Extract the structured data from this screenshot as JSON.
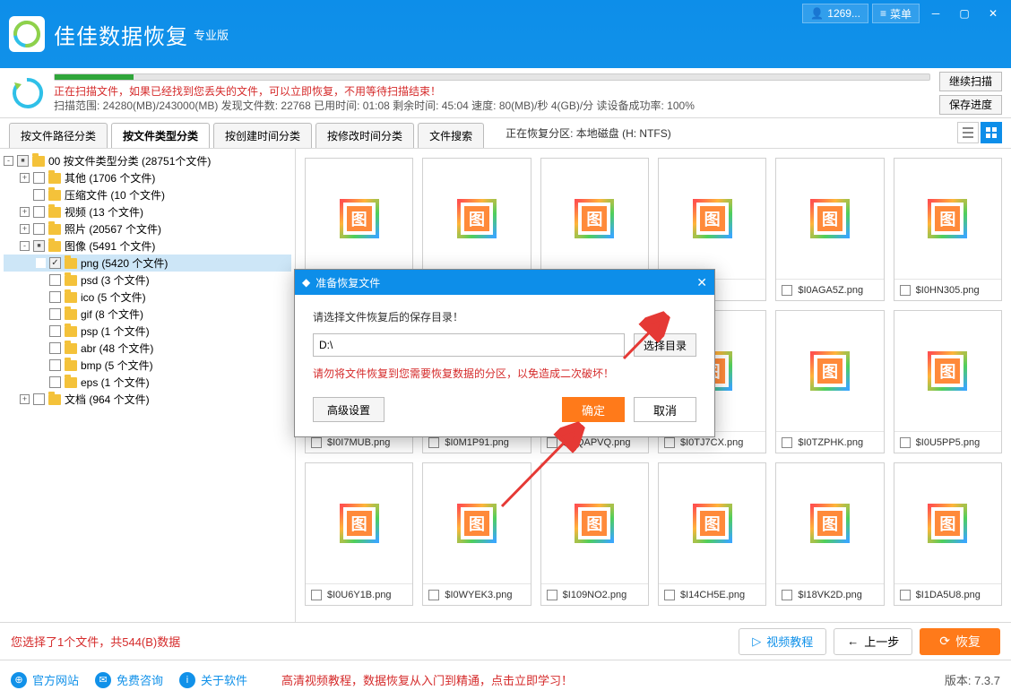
{
  "titlebar": {
    "app_name": "佳佳数据恢复",
    "edition": "专业版",
    "user_btn": "1269...",
    "menu_btn": "菜单"
  },
  "progress": {
    "scanning_msg": "正在扫描文件，如果已经找到您丢失的文件，可以立即恢复，不用等待扫描结束！",
    "stats": "扫描范围: 24280(MB)/243000(MB)   发现文件数: 22768   已用时间: 01:08   剩余时间: 45:04   速度: 80(MB)/秒 4(GB)/分 读设备成功率: 100%",
    "continue_btn": "继续扫描",
    "save_btn": "保存进度"
  },
  "tabs": {
    "t1": "按文件路径分类",
    "t2": "按文件类型分类",
    "t3": "按创建时间分类",
    "t4": "按修改时间分类",
    "t5": "文件搜索",
    "partition": "正在恢复分区: 本地磁盘 (H: NTFS)"
  },
  "tree": {
    "root": "00 按文件类型分类   (28751个文件)",
    "other": "其他   (1706 个文件)",
    "archive": "压缩文件   (10 个文件)",
    "video": "视频   (13 个文件)",
    "photo": "照片   (20567 个文件)",
    "image": "图像   (5491 个文件)",
    "png": "png   (5420 个文件)",
    "psd": "psd   (3 个文件)",
    "ico": "ico   (5 个文件)",
    "gif": "gif   (8 个文件)",
    "psp": "psp   (1 个文件)",
    "abr": "abr   (48 个文件)",
    "bmp": "bmp   (5 个文件)",
    "eps": "eps   (1 个文件)",
    "doc": "文档   (964 个文件)"
  },
  "thumbs": [
    "",
    "",
    "",
    ".ng",
    "$I0AGA5Z.png",
    "$I0HN305.png",
    "$I0I7MUB.png",
    "$I0M1P91.png",
    "$I0QAPVQ.png",
    "$I0TJ7CX.png",
    "$I0TZPHK.png",
    "$I0U5PP5.png",
    "$I0U6Y1B.png",
    "$I0WYEK3.png",
    "$I109NO2.png",
    "$I14CH5E.png",
    "$I18VK2D.png",
    "$I1DA5U8.png"
  ],
  "modal": {
    "title": "准备恢复文件",
    "label": "请选择文件恢复后的保存目录！",
    "path": "D:\\",
    "browse_btn": "选择目录",
    "warn": "请勿将文件恢复到您需要恢复数据的分区，以免造成二次破坏！",
    "adv_btn": "高级设置",
    "ok_btn": "确定",
    "cancel_btn": "取消"
  },
  "footer": {
    "selection": "您选择了1个文件，共544(B)数据",
    "video_btn": "视频教程",
    "prev_btn": "上一步",
    "recover_btn": "恢复"
  },
  "linkbar": {
    "l1": "官方网站",
    "l2": "免费咨询",
    "l3": "关于软件",
    "promo": "高清视频教程，数据恢复从入门到精通，点击立即学习！",
    "version": "版本: 7.3.7"
  }
}
